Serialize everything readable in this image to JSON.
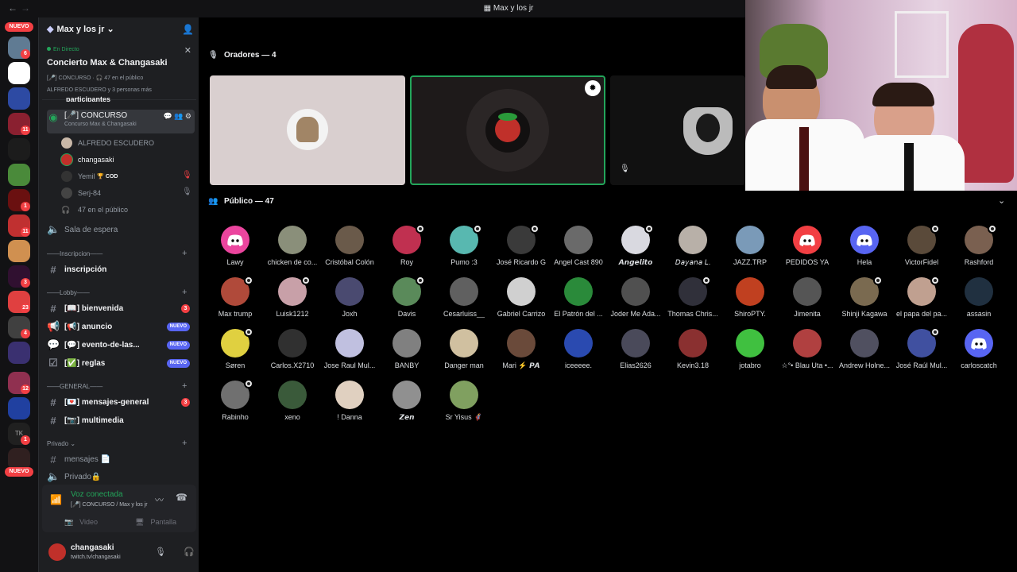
{
  "titlebar": {
    "title": "Max y los jr",
    "back": "←",
    "forward": "→"
  },
  "guilds": {
    "badges": [
      "6",
      "11",
      "11",
      "1",
      "11",
      "3",
      "23",
      "4",
      "12",
      "1"
    ],
    "new_label": "NUEVO",
    "new_label_bottom": "NUEVO"
  },
  "sidebar": {
    "server_name": "Max y los jr",
    "stage": {
      "live": "En Directo",
      "title": "Concierto Max & Changasaki",
      "sub": "[🎤] CONCURSO · 🎧 47 en el público",
      "sub2": "ALFREDO ESCUDERO y 3 personas más",
      "partial": "participantes"
    },
    "stage_channel": {
      "name": "[🎤] CONCURSO",
      "topic": "Concurso Max & Changasaki"
    },
    "members": [
      "ALFREDO ESCUDERO",
      "changasaki",
      "Yemil",
      "Serj-84",
      "47 en el público"
    ],
    "yemil_tag": "🏆 COD",
    "waiting": "Sala de espera",
    "cat_inscripcion": "——Inscripcion——",
    "ch_inscripcion": "inscripción",
    "cat_lobby": "——Lobby——",
    "ch_bienvenida": "[📖] bienvenida",
    "ch_bienvenida_badge": "3",
    "ch_anuncio": "[📢] anuncio",
    "ch_evento": "[💬] evento-de-las...",
    "ch_reglas": "[✅] reglas",
    "nuevo": "NUEVO",
    "cat_general": "——GENERAL——",
    "ch_mensajes": "[💌] mensajes-general",
    "ch_mensajes_badge": "3",
    "ch_multimedia": "[📷] multimedia",
    "cat_privado": "Privado",
    "ch_privmsg": "mensajes 📄",
    "ch_privado": "Privado🔒"
  },
  "voice": {
    "title": "Voz conectada",
    "sub": "[🎤] CONCURSO / Max y los jr",
    "video": "Video",
    "screen": "Pantalla"
  },
  "user": {
    "name": "changasaki",
    "status": "twitch.tv/changasaki"
  },
  "main": {
    "speakers_label": "Oradores — 4",
    "public_label": "Público — 47",
    "public": [
      "Lawy",
      "chicken de co...",
      "Cristóbal Colón",
      "Roy",
      "Pumo :3",
      "José Ricardo G",
      "Angel Cast 890",
      "𝘼𝙣𝙜𝙚𝙡𝙞𝙩𝙤",
      "𝘋𝘢𝘺𝘢𝘯𝘢 𝘓.",
      "JAZZ.TRP",
      "PEDIDOS YA",
      "Hela",
      "VictorFidel",
      "Rashford",
      "Max trump",
      "Luisk1212",
      "Joxh",
      "Davis",
      "Cesarluiss__",
      "Gabriel Carrizo",
      "El Patrón del ...",
      "Joder Me Ada...",
      "Thomas Chris...",
      "ShiroPTY.",
      "Jimenita",
      "Shinji Kagawa",
      "el papa del pa...",
      "assasin",
      "Søren",
      "Carlos.X2710",
      "Jose Raul Mul...",
      "BANBY",
      "Danger man",
      "Mari ⚡ 𝙋𝘼",
      "iceeeee.",
      "Elias2626",
      "Kevin3.18",
      "jotabro",
      "☆°• Blau Uta •...",
      "Andrew Holne...",
      "José Raúl Mul...",
      "carloscatch",
      "Rabinho",
      "xeno",
      "! Danna",
      "𝙕𝙚𝙣",
      "Sr Yisus 🦸"
    ]
  },
  "colors": {
    "accent": "#5865f2",
    "online": "#23a55a",
    "danger": "#f23f43"
  }
}
